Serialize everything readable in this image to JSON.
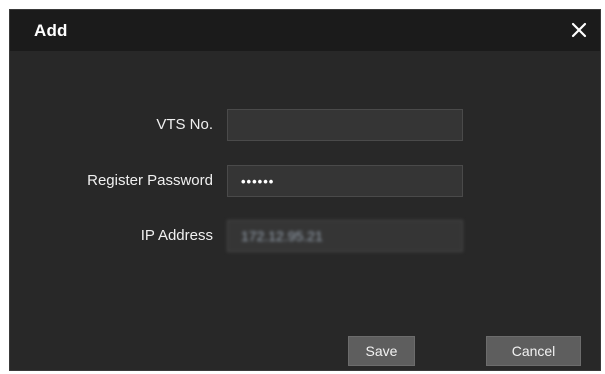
{
  "dialog": {
    "title": "Add",
    "close_icon": "close-icon"
  },
  "form": {
    "vts_no": {
      "label": "VTS No.",
      "value": ""
    },
    "register_password": {
      "label": "Register Password",
      "value": "••••••"
    },
    "ip_address": {
      "label": "IP Address",
      "value": "172.12.95.21"
    }
  },
  "buttons": {
    "save_label": "Save",
    "cancel_label": "Cancel"
  },
  "colors": {
    "dialog_bg": "#282828",
    "titlebar_bg": "#1b1b1b",
    "input_bg": "#353535",
    "button_bg": "#5e5e5e",
    "text": "#ffffff"
  }
}
